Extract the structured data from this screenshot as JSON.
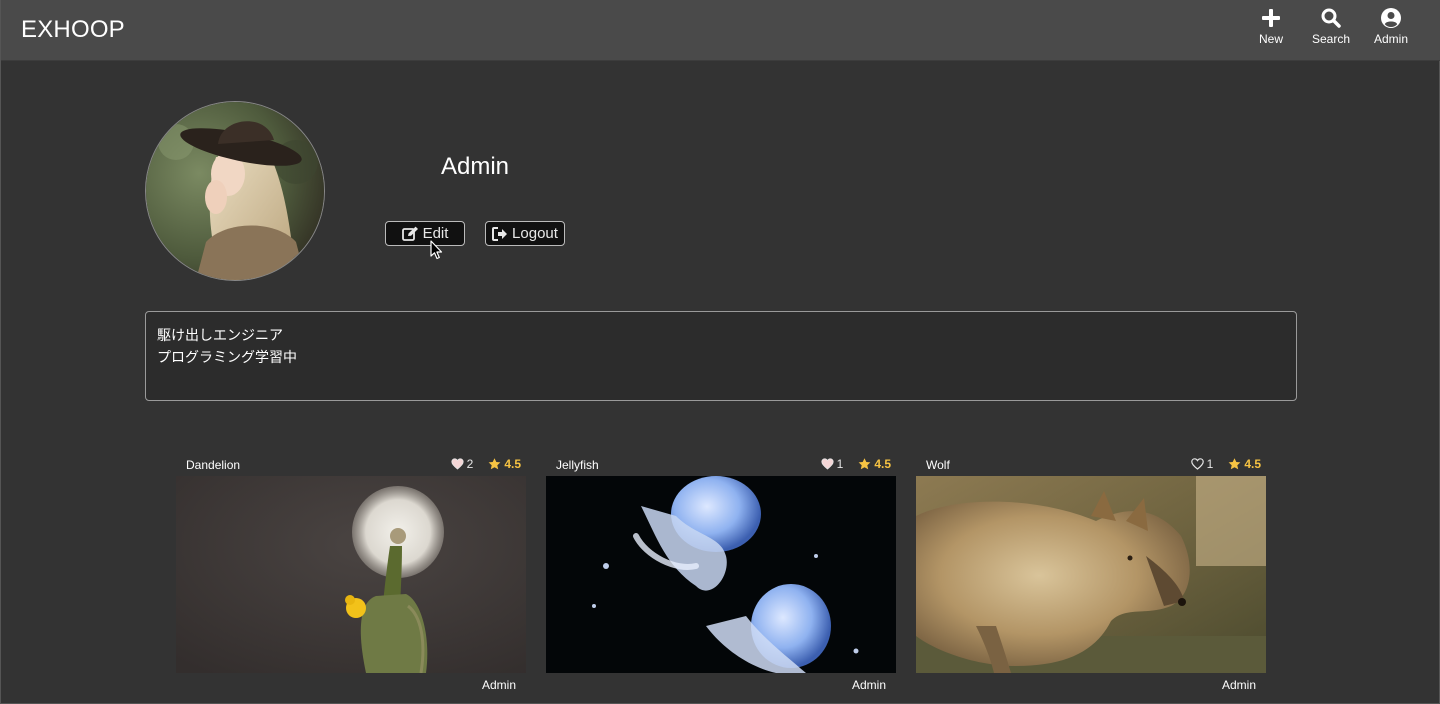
{
  "header": {
    "brand": "EXHOOP",
    "nav": {
      "new_label": "New",
      "search_label": "Search",
      "admin_label": "Admin"
    }
  },
  "profile": {
    "username": "Admin",
    "edit_label": "Edit",
    "logout_label": "Logout",
    "bio_lines": [
      "駆け出しエンジニア",
      "プログラミング学習中"
    ]
  },
  "posts": [
    {
      "title": "Dandelion",
      "likes": "2",
      "rating": "4.5",
      "author": "Admin",
      "liked": false
    },
    {
      "title": "Jellyfish",
      "likes": "1",
      "rating": "4.5",
      "author": "Admin",
      "liked": false
    },
    {
      "title": "Wolf",
      "likes": "1",
      "rating": "4.5",
      "author": "Admin",
      "liked": false
    }
  ],
  "colors": {
    "header_bg": "#4a4a4a",
    "page_bg": "#333333",
    "rating_star": "#f6c343"
  },
  "icons": [
    "plus-icon",
    "search-icon",
    "user-circle-icon",
    "edit-icon",
    "logout-icon",
    "heart-icon",
    "star-icon"
  ]
}
